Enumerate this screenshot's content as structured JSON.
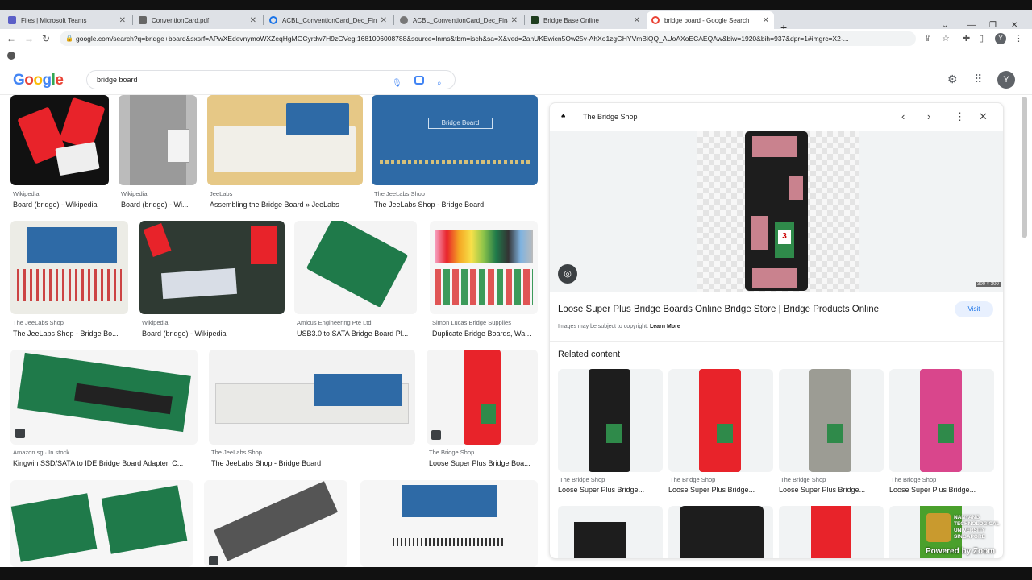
{
  "tabs": [
    {
      "label": "Files | Microsoft Teams",
      "icon": "teams-icon",
      "color": "#5b5fc7"
    },
    {
      "label": "ConventionCard.pdf",
      "icon": "pdf-icon",
      "color": "#555555"
    },
    {
      "label": "ACBL_ConventionCard_Dec_Final",
      "icon": "loading-icon",
      "color": "#1a73e8"
    },
    {
      "label": "ACBL_ConventionCard_Dec_Final",
      "icon": "globe-icon",
      "color": "#555555"
    },
    {
      "label": "Bridge Base Online",
      "icon": "bbo-icon",
      "color": "#1e3d1e"
    },
    {
      "label": "bridge board - Google Search",
      "icon": "google-icon",
      "color": "#ea4335"
    }
  ],
  "url": "google.com/search?q=bridge+board&sxsrf=APwXEdevnymoWXZeqHgMGCyrdw7H9zGVeg:1681006008788&source=lnms&tbm=isch&sa=X&ved=2ahUKEwicn5Ow25v-AhXo1zgGHYVmBiQQ_AUoAXoECAEQAw&biw=1920&bih=937&dpr=1#imgrc=X2-...",
  "google": {
    "query": "bridge board",
    "avatar_letter": "Y",
    "logo_letters": [
      {
        "ch": "G",
        "color": "#4285f4"
      },
      {
        "ch": "o",
        "color": "#ea4335"
      },
      {
        "ch": "o",
        "color": "#fbbc05"
      },
      {
        "ch": "g",
        "color": "#4285f4"
      },
      {
        "ch": "l",
        "color": "#34a853"
      },
      {
        "ch": "e",
        "color": "#ea4335"
      }
    ]
  },
  "results": [
    {
      "source": "Wikipedia",
      "title": "Board (bridge) - Wikipedia"
    },
    {
      "source": "Wikipedia",
      "title": "Board (bridge) - Wi..."
    },
    {
      "source": "JeeLabs",
      "title": "Assembling the Bridge Board » JeeLabs"
    },
    {
      "source": "The JeeLabs Shop",
      "title": "The JeeLabs Shop - Bridge Board"
    },
    {
      "source": "The JeeLabs Shop",
      "title": "The JeeLabs Shop - Bridge Bo..."
    },
    {
      "source": "Wikipedia",
      "title": "Board (bridge) - Wikipedia"
    },
    {
      "source": "Amicus Engineering Pte Ltd",
      "title": "USB3.0 to SATA Bridge Board Pl..."
    },
    {
      "source": "Simon Lucas Bridge Supplies",
      "title": "Duplicate Bridge Boards, Wa..."
    },
    {
      "source": "Amazon.sg · In stock",
      "title": "Kingwin SSD/SATA to IDE Bridge Board Adapter, C..."
    },
    {
      "source": "The JeeLabs Shop",
      "title": "The JeeLabs Shop - Bridge Board"
    },
    {
      "source": "The Bridge Shop",
      "title": "Loose Super Plus Bridge Boa..."
    }
  ],
  "panel": {
    "source": "The Bridge Shop",
    "title": "Loose Super Plus Bridge Boards Online Bridge Store | Bridge Products Online",
    "visit_label": "Visit",
    "copyright_text": "Images may be subject to copyright.",
    "learn_more": "Learn More",
    "related_heading": "Related content",
    "image_size": "300 × 300",
    "related": [
      {
        "source": "The Bridge Shop",
        "title": "Loose Super Plus Bridge..."
      },
      {
        "source": "The Bridge Shop",
        "title": "Loose Super Plus Bridge..."
      },
      {
        "source": "The Bridge Shop",
        "title": "Loose Super Plus Bridge..."
      },
      {
        "source": "The Bridge Shop",
        "title": "Loose Super Plus Bridge..."
      }
    ]
  },
  "overlay": {
    "ntu_text": "NANYANG TECHNOLOGICAL UNIVERSITY SINGAPORE",
    "zoom_text": "Powered by Zoom"
  },
  "colors": {
    "accent": "#1a73e8",
    "board_red": "#e8232a",
    "board_black": "#1d1d1d",
    "pcb_blue": "#2e6aa6",
    "pcb_green": "#1f7a4a"
  }
}
